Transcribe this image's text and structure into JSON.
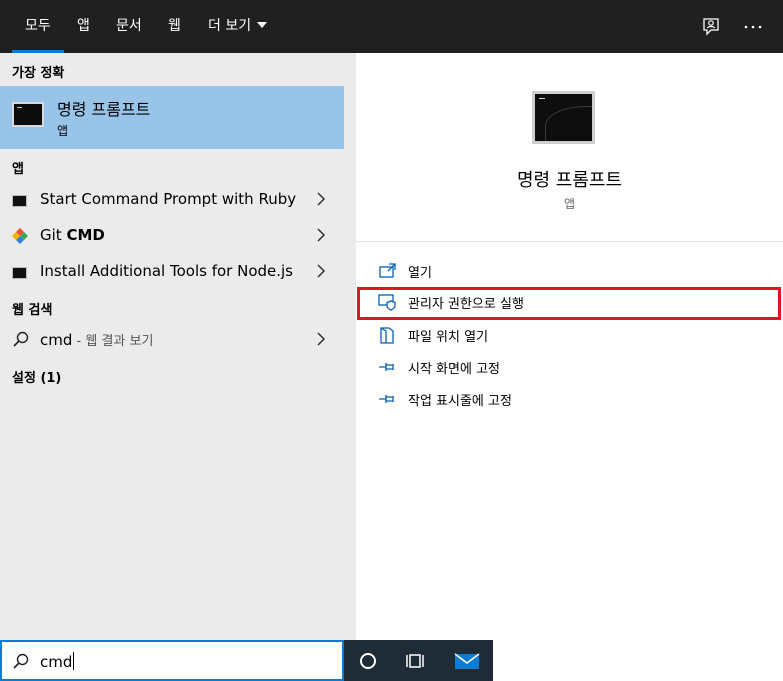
{
  "tabs": [
    {
      "label": "모두"
    },
    {
      "label": "앱"
    },
    {
      "label": "문서"
    },
    {
      "label": "웹"
    },
    {
      "label": "더 보기"
    }
  ],
  "left": {
    "best_match_header": "가장 정확",
    "best_match": {
      "title": "명령 프롬프트",
      "subtitle": "앱"
    },
    "apps_header": "앱",
    "apps": [
      {
        "label": "Start Command Prompt with Ruby"
      },
      {
        "label_plain": "Git ",
        "label_bold": "CMD"
      },
      {
        "label": "Install Additional Tools for Node.js"
      }
    ],
    "web_header": "웹 검색",
    "web": {
      "query": "cmd",
      "suffix": " - 웹 결과 보기"
    },
    "settings_header": "설정 (1)"
  },
  "preview": {
    "title": "명령 프롬프트",
    "subtitle": "앱",
    "actions": [
      {
        "label": "열기",
        "icon": "open-icon"
      },
      {
        "label": "관리자 권한으로 실행",
        "icon": "run-as-admin-icon"
      },
      {
        "label": "파일 위치 열기",
        "icon": "file-location-icon"
      },
      {
        "label": "시작 화면에 고정",
        "icon": "pin-icon"
      },
      {
        "label": "작업 표시줄에 고정",
        "icon": "pin-icon"
      }
    ]
  },
  "search": {
    "value": "cmd"
  },
  "colors": {
    "accent": "#0a7cd4",
    "highlight": "#e81123",
    "selected_bg": "#99c4e9",
    "topbar_bg": "#202020"
  }
}
